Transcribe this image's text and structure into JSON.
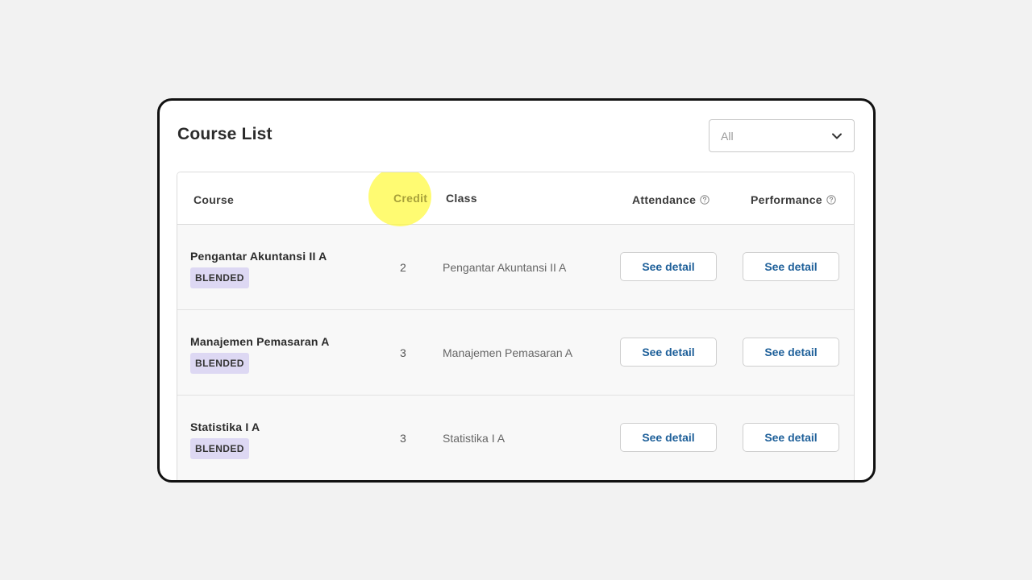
{
  "header": {
    "title": "Course List",
    "filter": {
      "selected": "All"
    }
  },
  "table": {
    "columns": {
      "course": "Course",
      "credit": "Credit",
      "class": "Class",
      "attendance": "Attendance",
      "performance": "Performance"
    },
    "rows": [
      {
        "course": "Pengantar Akuntansi II A",
        "badge": "BLENDED",
        "credit": "2",
        "class": "Pengantar Akuntansi II A",
        "attendance_btn": "See detail",
        "performance_btn": "See detail"
      },
      {
        "course": "Manajemen Pemasaran A",
        "badge": "BLENDED",
        "credit": "3",
        "class": "Manajemen Pemasaran A",
        "attendance_btn": "See detail",
        "performance_btn": "See detail"
      },
      {
        "course": "Statistika I A",
        "badge": "BLENDED",
        "credit": "3",
        "class": "Statistika I A",
        "attendance_btn": "See detail",
        "performance_btn": "See detail"
      }
    ]
  },
  "icons": {
    "filter": "chevron-down-icon",
    "help": "help-circle-icon"
  },
  "colors": {
    "button_text": "#1d5f99",
    "badge_bg": "#ddd8f3",
    "highlight": "#fffa3c"
  }
}
